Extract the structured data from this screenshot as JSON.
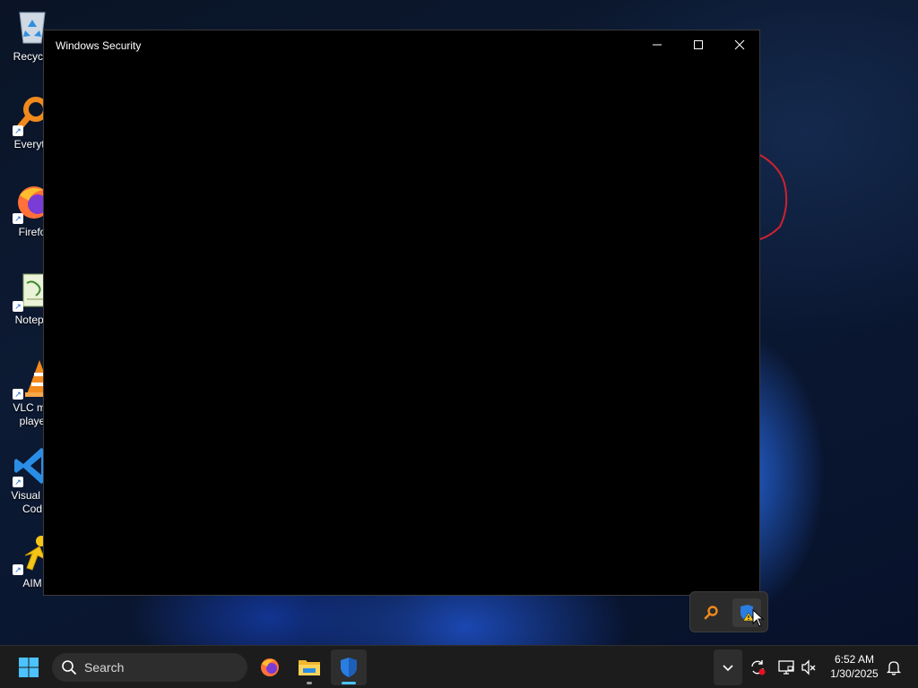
{
  "desktop": {
    "icons": [
      {
        "label": "Recycle",
        "icon": "recycle-bin-icon"
      },
      {
        "label": "Everyth",
        "icon": "everything-search-icon"
      },
      {
        "label": "Firefo",
        "icon": "firefox-icon"
      },
      {
        "label": "Notepa",
        "icon": "notepad-icon"
      },
      {
        "label": "VLC me\nplaye",
        "icon": "vlc-icon"
      },
      {
        "label": "Visual St\nCod",
        "icon": "vscode-icon"
      },
      {
        "label": "AIM",
        "icon": "aim-icon"
      }
    ]
  },
  "window": {
    "title": "Windows Security",
    "controls": [
      "minimize-icon",
      "maximize-icon",
      "close-icon"
    ]
  },
  "tray_flyout": {
    "items": [
      "everything-search-icon",
      "windows-security-warning-icon"
    ]
  },
  "taskbar": {
    "search_label": "Search",
    "pinned": [
      "firefox-icon",
      "file-explorer-icon",
      "windows-security-icon"
    ],
    "tray": [
      "chevron-up-icon",
      "sync-icon",
      "display-icon",
      "volume-muted-icon",
      "notification-bell-icon"
    ],
    "clock": {
      "time": "6:52 AM",
      "date": "1/30/2025"
    }
  },
  "colors": {
    "accent": "#4cc2ff",
    "window_bg": "#000000",
    "taskbar_bg": "#1c1c1c"
  }
}
